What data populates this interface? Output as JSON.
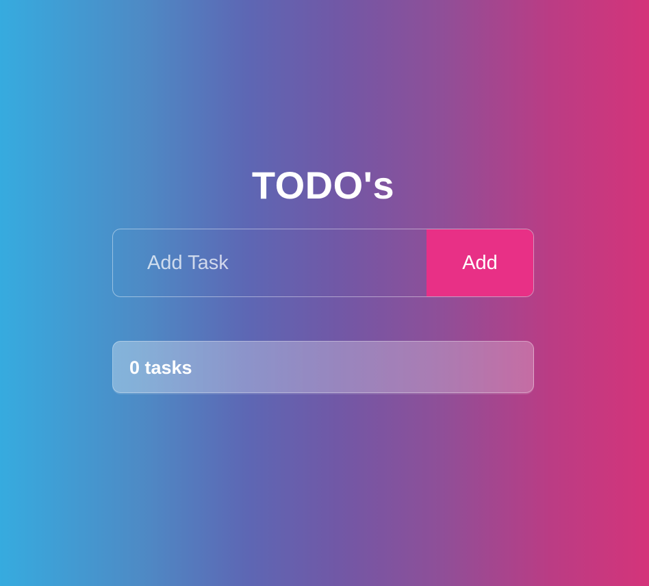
{
  "app": {
    "title": "TODO's"
  },
  "form": {
    "input_placeholder": "Add Task",
    "input_value": "",
    "add_label": "Add"
  },
  "tasks": {
    "count_label": "0 tasks",
    "items": []
  },
  "colors": {
    "gradient_left": "#36abdf",
    "gradient_mid": "#7158a6",
    "gradient_right": "#d4347a",
    "accent": "#e83086",
    "text": "#ffffff"
  }
}
